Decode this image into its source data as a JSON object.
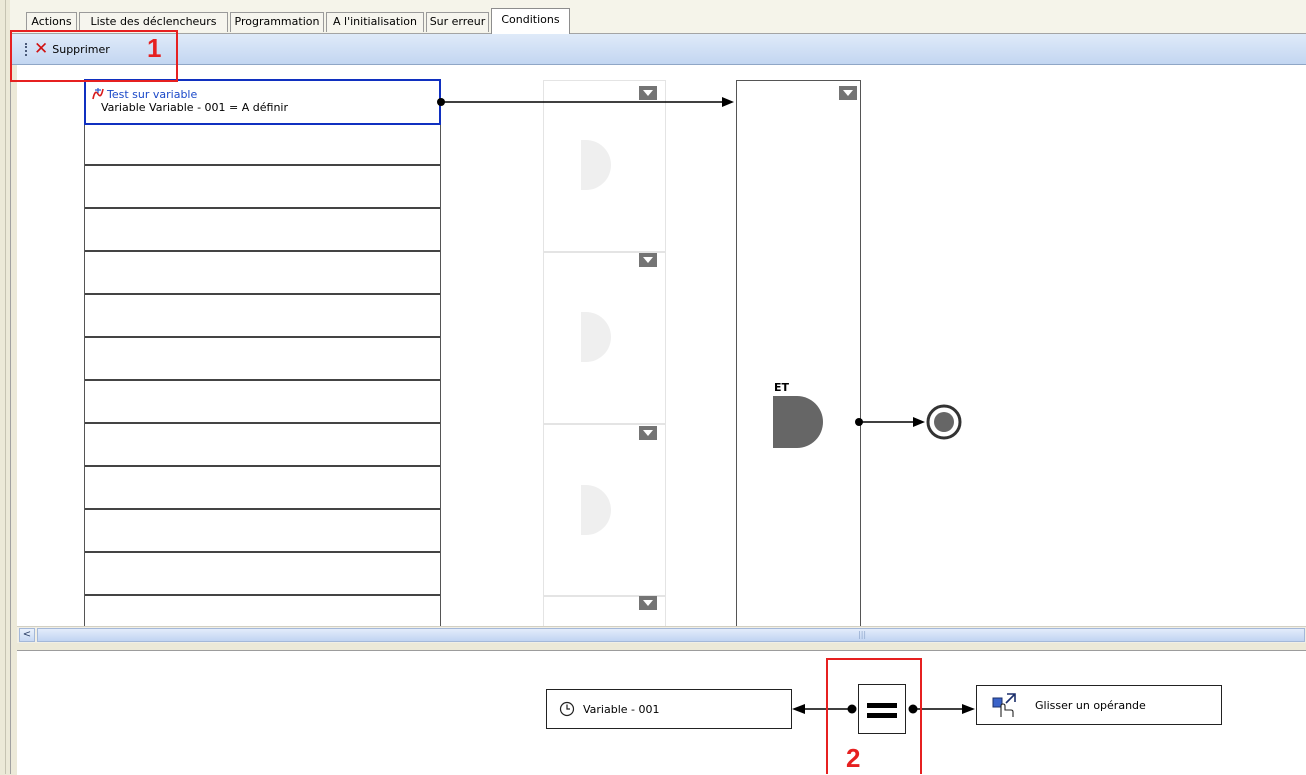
{
  "tabs": [
    {
      "label": "Actions"
    },
    {
      "label": "Liste des déclencheurs"
    },
    {
      "label": "Programmation"
    },
    {
      "label": "A l'initialisation"
    },
    {
      "label": "Sur erreur"
    },
    {
      "label": "Conditions",
      "active": true
    }
  ],
  "toolbar": {
    "delete_label": "Supprimer",
    "delete_icon": "delete-x-icon"
  },
  "annotations": {
    "one": "1",
    "two": "2",
    "color": "#e62020"
  },
  "condition": {
    "title": "Test sur variable",
    "subtitle": "Variable Variable - 001 = A définir",
    "icon": "variable-test-icon"
  },
  "gate": {
    "label": "ET"
  },
  "editor": {
    "left_operand": "Variable - 001",
    "left_icon": "clock-icon",
    "right_operand": "Glisser un opérande",
    "right_icon": "drag-hand-icon",
    "operator": "equals"
  },
  "colors": {
    "selection": "#1030c0",
    "link": "#1a48c8",
    "toolbar": "#c3d6f1"
  }
}
